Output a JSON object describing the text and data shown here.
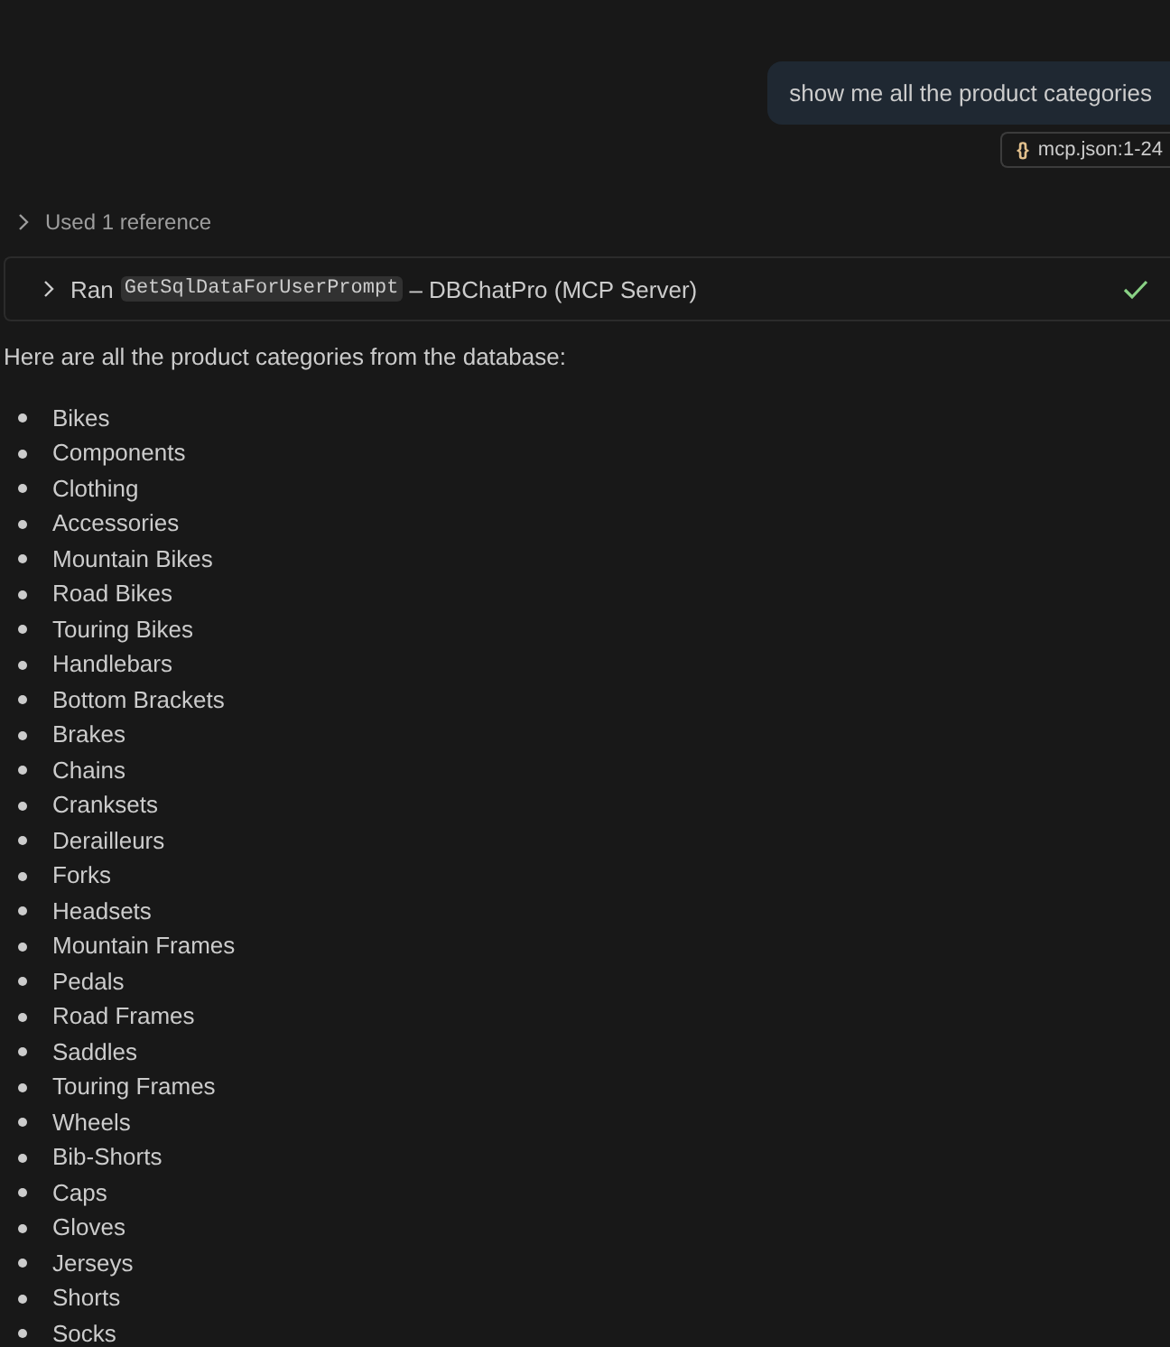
{
  "user_message": {
    "text": "show me all the product categories",
    "reference": {
      "icon": "{}",
      "label": "mcp.json:1-24"
    }
  },
  "references": {
    "label": "Used 1 reference",
    "expanded": false
  },
  "tool_call": {
    "expanded": false,
    "verb": "Ran",
    "tool": "GetSqlDataForUserPrompt",
    "source": "– DBChatPro (MCP Server)",
    "completed": true
  },
  "response": {
    "intro": "Here are all the product categories from the database:",
    "items": [
      "Bikes",
      "Components",
      "Clothing",
      "Accessories",
      "Mountain Bikes",
      "Road Bikes",
      "Touring Bikes",
      "Handlebars",
      "Bottom Brackets",
      "Brakes",
      "Chains",
      "Cranksets",
      "Derailleurs",
      "Forks",
      "Headsets",
      "Mountain Frames",
      "Pedals",
      "Road Frames",
      "Saddles",
      "Touring Frames",
      "Wheels",
      "Bib-Shorts",
      "Caps",
      "Gloves",
      "Jerseys",
      "Shorts",
      "Socks"
    ]
  }
}
